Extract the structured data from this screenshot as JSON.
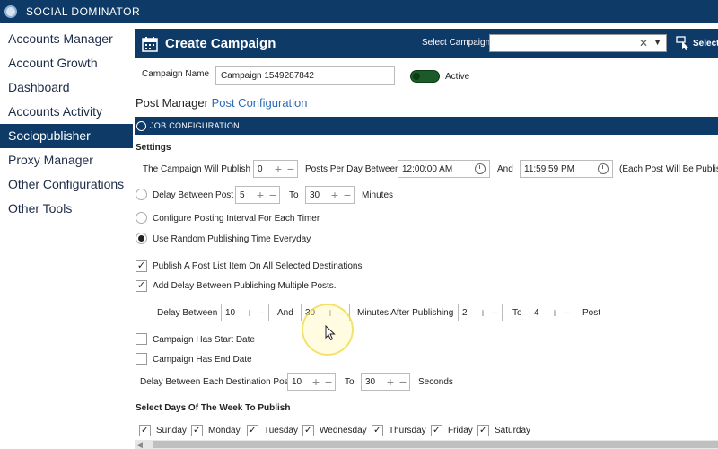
{
  "app": {
    "title": "SOCIAL DOMINATOR"
  },
  "sidebar": {
    "items": [
      {
        "label": "Accounts Manager"
      },
      {
        "label": "Account Growth"
      },
      {
        "label": "Dashboard"
      },
      {
        "label": "Accounts Activity"
      },
      {
        "label": "Sociopublisher",
        "active": true
      },
      {
        "label": "Proxy Manager"
      },
      {
        "label": "Other Configurations"
      },
      {
        "label": "Other Tools"
      }
    ]
  },
  "header": {
    "title": "Create Campaign",
    "select_label": "Select Campaign",
    "select_value": "",
    "select_button": "Select"
  },
  "campaign": {
    "name_label": "Campaign Name",
    "name_value": "Campaign 1549287842",
    "active_label": "Active",
    "active": true
  },
  "tabs": {
    "label_1": "Post Manager",
    "label_2": "Post Configuration"
  },
  "job_config": {
    "header": "JOB CONFIGURATION"
  },
  "settings": {
    "heading": "Settings",
    "publish_label": "The Campaign Will Publish",
    "posts_per_day": "0",
    "posts_per_day_between": "Posts Per Day Between",
    "start_time": "12:00:00 AM",
    "and": "And",
    "end_time": "11:59:59 PM",
    "each_post_note": "(Each Post Will Be Published",
    "delay_between_post_label": "Delay Between Post",
    "delay_post_from": "5",
    "to": "To",
    "delay_post_to": "30",
    "minutes": "Minutes",
    "configure_interval_label": "Configure Posting Interval For Each Timer",
    "random_time_label": "Use Random Publishing Time Everyday",
    "random_time_selected": true,
    "publish_all_label": "Publish A Post List Item On All Selected Destinations",
    "publish_all_checked": true,
    "add_delay_label": "Add Delay Between Publishing Multiple Posts.",
    "add_delay_checked": true,
    "delay_between_label": "Delay Between",
    "delay_from": "10",
    "and2": "And",
    "delay_to": "30",
    "minutes_after": "Minutes After Publishing",
    "after_from": "2",
    "to2": "To",
    "after_to": "4",
    "post": "Post",
    "start_date_label": "Campaign Has Start Date",
    "start_date_checked": false,
    "end_date_label": "Campaign Has End Date",
    "end_date_checked": false,
    "dest_delay_label": "Delay Between Each Destination Post",
    "dest_from": "10",
    "to3": "To",
    "dest_to": "30",
    "seconds": "Seconds",
    "days_heading": "Select Days Of The Week To Publish",
    "days": [
      {
        "label": "Sunday",
        "checked": true
      },
      {
        "label": "Monday",
        "checked": true
      },
      {
        "label": "Tuesday",
        "checked": true
      },
      {
        "label": "Wednesday",
        "checked": true
      },
      {
        "label": "Thursday",
        "checked": true
      },
      {
        "label": "Friday",
        "checked": true
      },
      {
        "label": "Saturday",
        "checked": true
      }
    ]
  },
  "colors": {
    "primary": "#0e3a68",
    "link": "#2b6cb3",
    "toggle": "#1c5a2a"
  }
}
